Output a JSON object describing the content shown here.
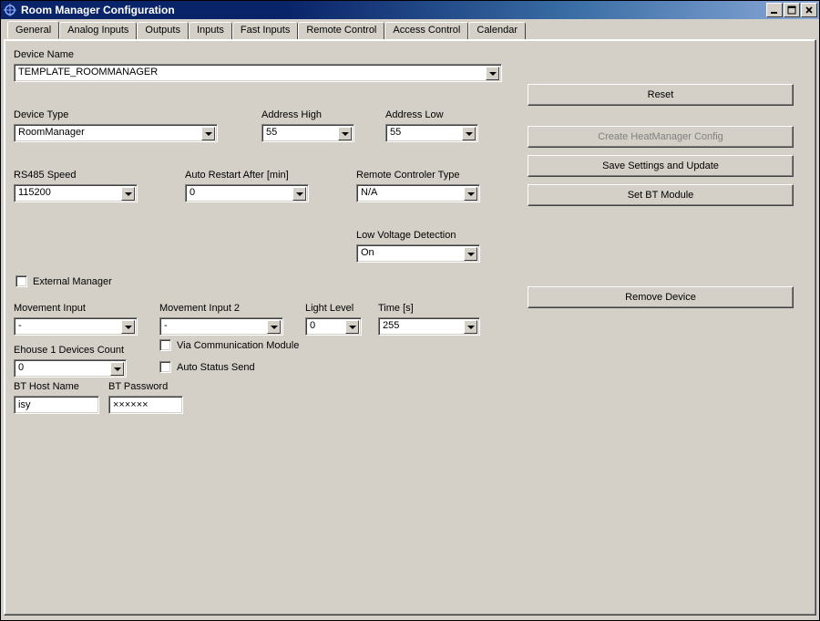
{
  "window": {
    "title": "Room Manager Configuration"
  },
  "tabs": {
    "t0": "General",
    "t1": "Analog Inputs",
    "t2": "Outputs",
    "t3": "Inputs",
    "t4": "Fast Inputs",
    "t5": "Remote Control",
    "t6": "Access Control",
    "t7": "Calendar"
  },
  "labels": {
    "device_name": "Device Name",
    "device_type": "Device Type",
    "address_high": "Address High",
    "address_low": "Address Low",
    "rs485_speed": "RS485 Speed",
    "auto_restart": "Auto Restart After [min]",
    "remote_controller_type": "Remote Controler Type",
    "low_voltage_detection": "Low Voltage Detection",
    "external_manager": "External Manager",
    "movement_input": "Movement Input",
    "movement_input_2": "Movement Input 2",
    "light_level": "Light Level",
    "time_s": "Time [s]",
    "via_comm_module": "Via Communication Module",
    "ehouse1_count": "Ehouse 1 Devices Count",
    "auto_status_send": "Auto Status Send",
    "bt_host_name": "BT Host Name",
    "bt_password": "BT Password"
  },
  "values": {
    "device_name": "TEMPLATE_ROOMMANAGER",
    "device_type": "RoomManager",
    "address_high": "55",
    "address_low": "55",
    "rs485_speed": "115200",
    "auto_restart": "0",
    "remote_controller_type": "N/A",
    "low_voltage_detection": "On",
    "movement_input": "-",
    "movement_input_2": "-",
    "light_level": "0",
    "time_s": "255",
    "ehouse1_count": "0",
    "bt_host_name": "isy",
    "bt_password": "××××××"
  },
  "buttons": {
    "reset": "Reset",
    "create_heatmanager": "Create HeatManager Config",
    "save_settings": "Save Settings and Update",
    "set_bt_module": "Set BT Module",
    "remove_device": "Remove Device"
  }
}
